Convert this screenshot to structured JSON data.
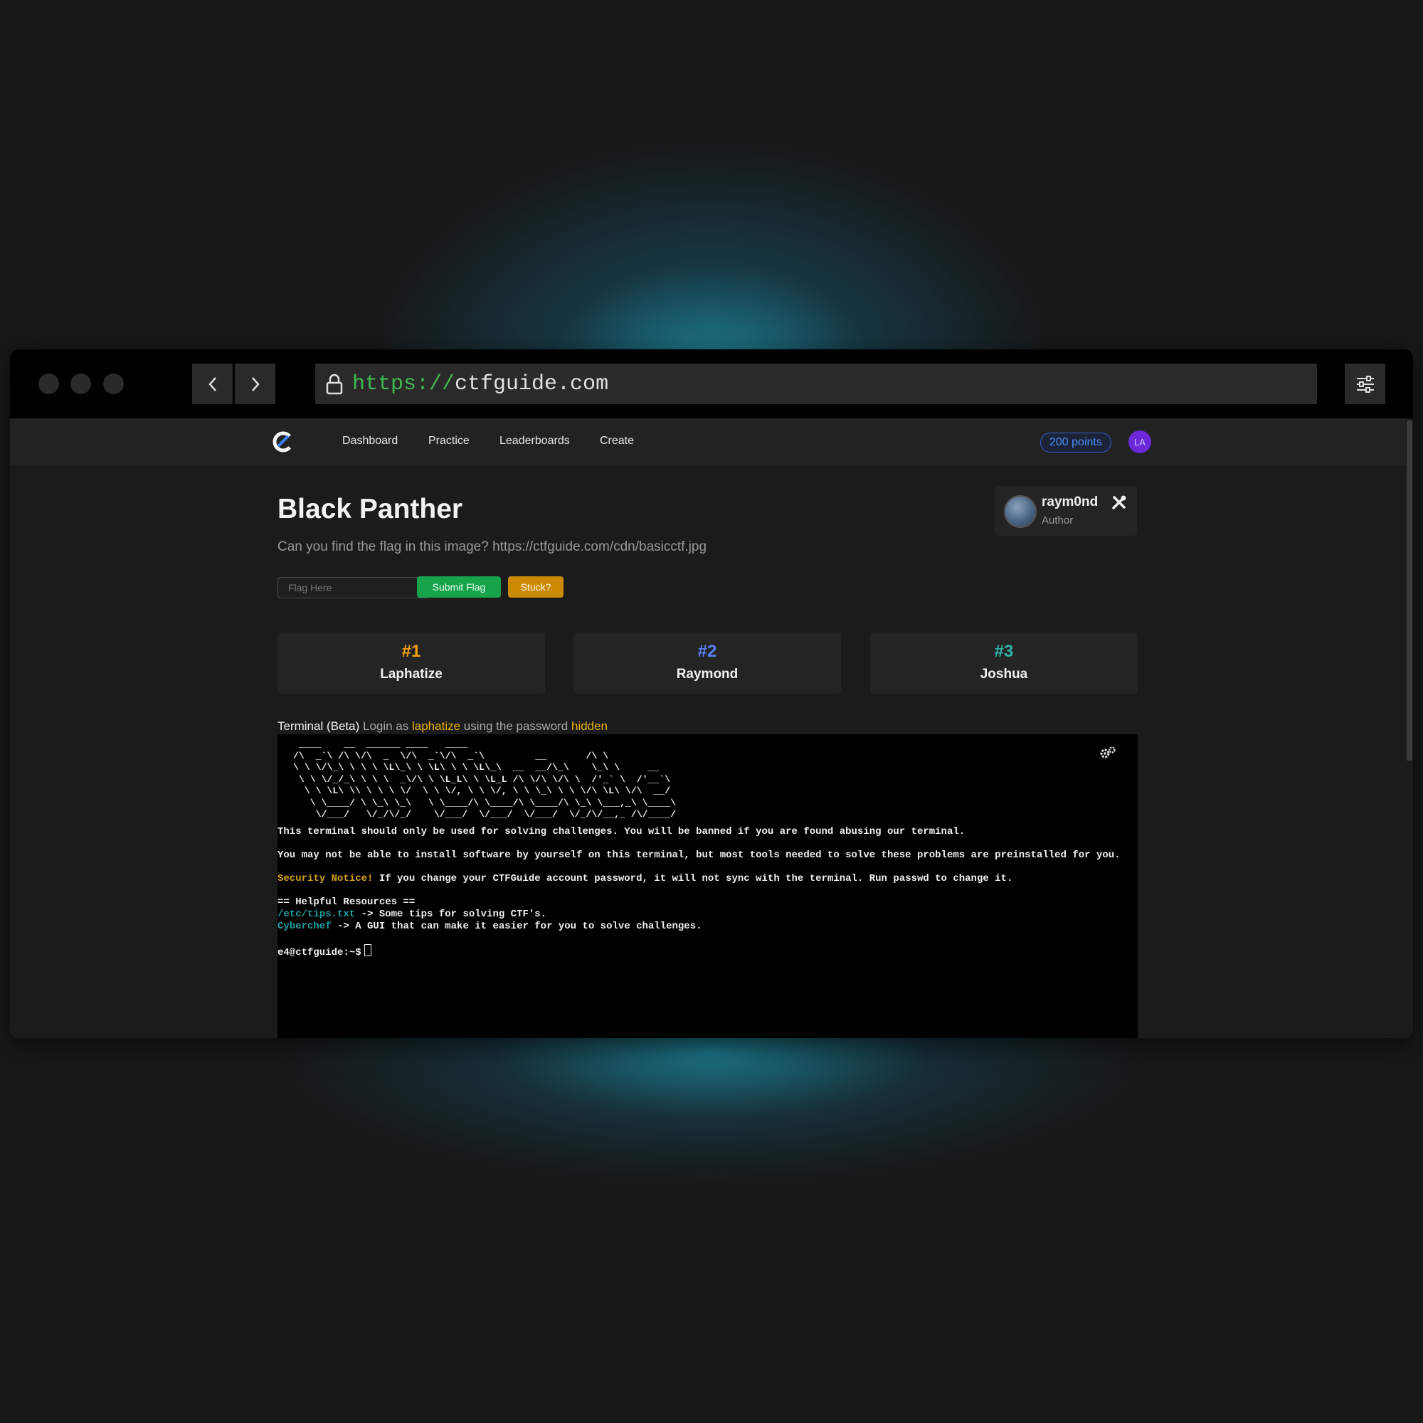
{
  "browser": {
    "url_scheme": "https://",
    "url_host": "ctfguide.com"
  },
  "nav": {
    "links": [
      "Dashboard",
      "Practice",
      "Leaderboards",
      "Create"
    ],
    "points": "200 points",
    "avatar_initials": "LA"
  },
  "challenge": {
    "title": "Black Panther",
    "description": "Can you find the flag in this image? https://ctfguide.com/cdn/basicctf.jpg",
    "flag_placeholder": "Flag Here",
    "submit_label": "Submit Flag",
    "stuck_label": "Stuck?"
  },
  "author": {
    "name": "raym0nd",
    "role": "Author"
  },
  "leaderboard": [
    {
      "rank": "#1",
      "name": "Laphatize",
      "color": "#f59e0b"
    },
    {
      "rank": "#2",
      "name": "Raymond",
      "color": "#5b7cf6"
    },
    {
      "rank": "#3",
      "name": "Joshua",
      "color": "#2fb3a8"
    }
  ],
  "terminal_info": {
    "label": "Terminal (Beta)",
    "text_login_as": " Login as ",
    "username": "laphatize",
    "text_using": " using the password ",
    "password": "hidden"
  },
  "terminal": {
    "ascii_banner": " ____    __  ______ ____   ____\n/\\  _`\\ /\\ \\/\\  _  \\/\\  _`\\/\\  _`\\         __       /\\ \\\n\\ \\ \\/\\_\\ \\ \\ \\ \\L\\_\\ \\ \\L\\ \\ \\ \\L\\_\\  __  __/\\_\\    \\_\\ \\     __\n \\ \\ \\/_/_\\ \\ \\ \\  _\\/\\ \\ \\L_L\\ \\ \\L_L /\\ \\/\\ \\/\\ \\  /'_` \\  /'__`\\\n  \\ \\ \\L\\ \\\\ \\ \\ \\ \\/  \\ \\ \\/, \\ \\ \\/, \\ \\ \\_\\ \\ \\ \\/\\ \\L\\ \\/\\  __/\n   \\ \\____/ \\ \\_\\ \\_\\   \\ \\____/\\ \\____/\\ \\____/\\ \\_\\ \\___,_\\ \\____\\\n    \\/___/   \\/_/\\/_/    \\/___/  \\/___/  \\/___/  \\/_/\\/__,_ /\\/____/",
    "line1": "This terminal should only be used for solving challenges. You will be banned if you are found abusing our terminal.",
    "line2": "You may not be able to install software by yourself on this terminal, but most tools needed to solve these problems are preinstalled for you.",
    "notice_label": "Security Notice!",
    "notice_text": " If you change your CTFGuide account password, it will not sync with the terminal. Run passwd to change it.",
    "resources_heading": "== Helpful Resources ==",
    "res1_link": "/etc/tips.txt",
    "res1_text": " -> Some tips for solving CTF's.",
    "res2_link": "Cyberchef",
    "res2_text": " -> A GUI that can make it easier for you to solve challenges.",
    "prompt": "e4@ctfguide:~$"
  }
}
